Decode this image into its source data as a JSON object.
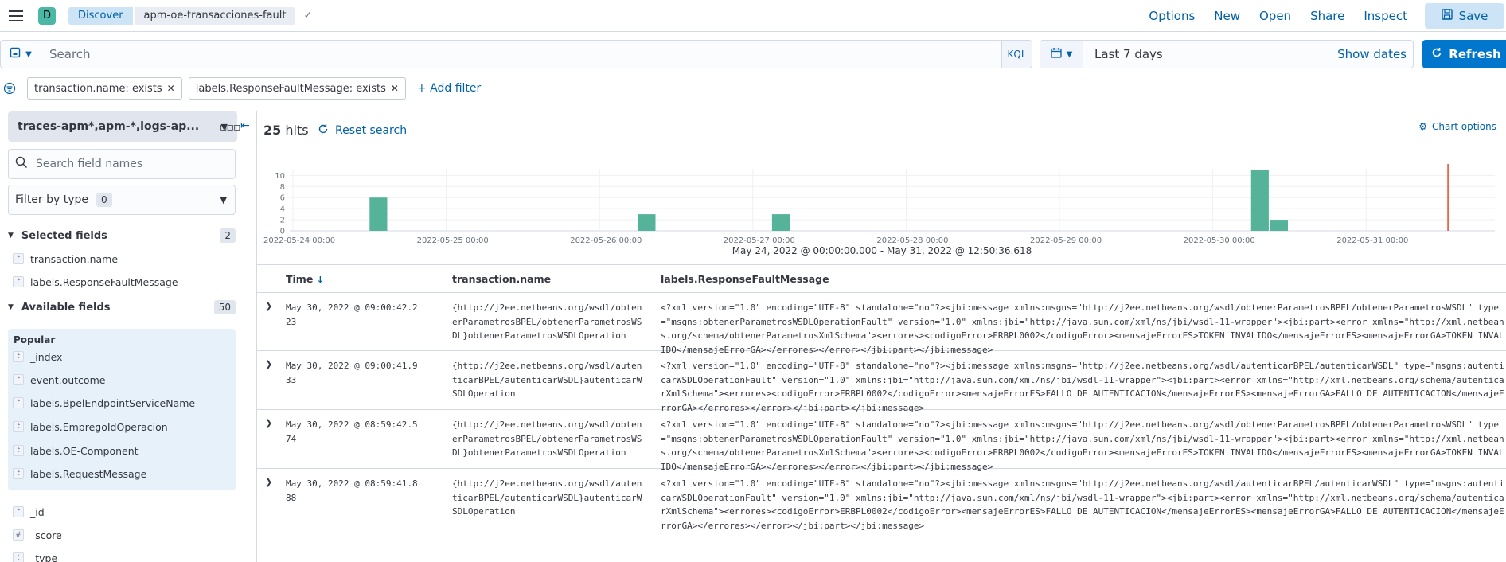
{
  "header": {
    "avatar_letter": "D",
    "breadcrumb_discover": "Discover",
    "breadcrumb_search": "apm-oe-transacciones-fault",
    "nav": [
      "Options",
      "New",
      "Open",
      "Share",
      "Inspect"
    ],
    "save_label": "Save"
  },
  "querybar": {
    "search_placeholder": "Search",
    "kql_label": "KQL",
    "date_label": "Last 7 days",
    "show_dates_label": "Show dates",
    "refresh_label": "Refresh"
  },
  "filters": {
    "pills": [
      "transaction.name: exists",
      "labels.ResponseFaultMessage: exists"
    ],
    "add_filter_label": "+ Add filter"
  },
  "sidebar": {
    "index_pattern": "traces-apm*,apm-*,logs-ap...",
    "field_search_placeholder": "Search field names",
    "filter_by_type_label": "Filter by type",
    "filter_by_type_count": "0",
    "selected_fields_label": "Selected fields",
    "selected_fields_count": "2",
    "selected_fields": [
      "transaction.name",
      "labels.ResponseFaultMessage"
    ],
    "available_fields_label": "Available fields",
    "available_fields_count": "50",
    "popular_label": "Popular",
    "popular_fields": [
      "_index",
      "event.outcome",
      "labels.BpelEndpointServiceName",
      "labels.EmpregoIdOperacion",
      "labels.OE-Component",
      "labels.RequestMessage"
    ],
    "other_fields": [
      {
        "type": "t",
        "name": "_id"
      },
      {
        "type": "#",
        "name": "_score"
      },
      {
        "type": "t",
        "name": "_type"
      }
    ]
  },
  "main": {
    "hits_count": "25",
    "hits_label": "hits",
    "reset_search_label": "Reset search",
    "chart_options_label": "Chart options",
    "chart_range": "May 24, 2022 @ 00:00:00.000 - May 31, 2022 @ 12:50:36.618",
    "columns": [
      "Time",
      "transaction.name",
      "labels.ResponseFaultMessage"
    ],
    "rows": [
      {
        "time": "May 30, 2022 @ 09:00:42.223",
        "name": "{http://j2ee.netbeans.org/wsdl/obtenerParametrosBPEL/obtenerParametrosWSDL}obtenerParametrosWSDLOperation",
        "msg": "<?xml version=\"1.0\" encoding=\"UTF-8\" standalone=\"no\"?><jbi:message xmlns:msgns=\"http://j2ee.netbeans.org/wsdl/obtenerParametrosBPEL/obtenerParametrosWSDL\" type=\"msgns:obtenerParametrosWSDLOperationFault\" version=\"1.0\" xmlns:jbi=\"http://java.sun.com/xml/ns/jbi/wsdl-11-wrapper\"><jbi:part><error xmlns=\"http://xml.netbeans.org/schema/obtenerParametrosXmlSchema\"><errores><codigoError>ERBPL0002</codigoError><mensajeErrorES>TOKEN INVALIDO</mensajeErrorES><mensajeErrorGA>TOKEN INVALIDO</mensajeErrorGA></errores></error></jbi:part></jbi:message>"
      },
      {
        "time": "May 30, 2022 @ 09:00:41.933",
        "name": "{http://j2ee.netbeans.org/wsdl/autenticarBPEL/autenticarWSDL}autenticarWSDLOperation",
        "msg": "<?xml version=\"1.0\" encoding=\"UTF-8\" standalone=\"no\"?><jbi:message xmlns:msgns=\"http://j2ee.netbeans.org/wsdl/autenticarBPEL/autenticarWSDL\" type=\"msgns:autenticarWSDLOperationFault\" version=\"1.0\" xmlns:jbi=\"http://java.sun.com/xml/ns/jbi/wsdl-11-wrapper\"><jbi:part><error xmlns=\"http://xml.netbeans.org/schema/autenticarXmlSchema\"><errores><codigoError>ERBPL0002</codigoError><mensajeErrorES>FALLO DE AUTENTICACION</mensajeErrorES><mensajeErrorGA>FALLO DE AUTENTICACION</mensajeErrorGA></errores></error></jbi:part></jbi:message>"
      },
      {
        "time": "May 30, 2022 @ 08:59:42.574",
        "name": "{http://j2ee.netbeans.org/wsdl/obtenerParametrosBPEL/obtenerParametrosWSDL}obtenerParametrosWSDLOperation",
        "msg": "<?xml version=\"1.0\" encoding=\"UTF-8\" standalone=\"no\"?><jbi:message xmlns:msgns=\"http://j2ee.netbeans.org/wsdl/obtenerParametrosBPEL/obtenerParametrosWSDL\" type=\"msgns:obtenerParametrosWSDLOperationFault\" version=\"1.0\" xmlns:jbi=\"http://java.sun.com/xml/ns/jbi/wsdl-11-wrapper\"><jbi:part><error xmlns=\"http://xml.netbeans.org/schema/obtenerParametrosXmlSchema\"><errores><codigoError>ERBPL0002</codigoError><mensajeErrorES>TOKEN INVALIDO</mensajeErrorES><mensajeErrorGA>TOKEN INVALIDO</mensajeErrorGA></errores></error></jbi:part></jbi:message>"
      },
      {
        "time": "May 30, 2022 @ 08:59:41.888",
        "name": "{http://j2ee.netbeans.org/wsdl/autenticarBPEL/autenticarWSDL}autenticarWSDLOperation",
        "msg": "<?xml version=\"1.0\" encoding=\"UTF-8\" standalone=\"no\"?><jbi:message xmlns:msgns=\"http://j2ee.netbeans.org/wsdl/autenticarBPEL/autenticarWSDL\" type=\"msgns:autenticarWSDLOperationFault\" version=\"1.0\" xmlns:jbi=\"http://java.sun.com/xml/ns/jbi/wsdl-11-wrapper\"><jbi:part><error xmlns=\"http://xml.netbeans.org/schema/autenticarXmlSchema\"><errores><codigoError>ERBPL0002</codigoError><mensajeErrorES>FALLO DE AUTENTICACION</mensajeErrorES><mensajeErrorGA>FALLO DE AUTENTICACION</mensajeErrorGA></errores></error></jbi:part></jbi:message>"
      }
    ]
  },
  "chart_data": {
    "type": "bar",
    "title": "",
    "xlabel": "",
    "ylabel": "",
    "ylim": [
      0,
      10
    ],
    "yticks": [
      0,
      2,
      4,
      6,
      8,
      10
    ],
    "xticks": [
      "2022-05-24 00:00",
      "2022-05-25 00:00",
      "2022-05-26 00:00",
      "2022-05-27 00:00",
      "2022-05-28 00:00",
      "2022-05-29 00:00",
      "2022-05-30 00:00",
      "2022-05-31 00:00"
    ],
    "x_range": [
      "2022-05-24 00:00",
      "2022-05-31 12:50"
    ],
    "bucket_hours": 3,
    "bars": [
      {
        "x": "2022-05-24 12:00",
        "value": 6
      },
      {
        "x": "2022-05-26 06:00",
        "value": 3
      },
      {
        "x": "2022-05-27 03:00",
        "value": 3
      },
      {
        "x": "2022-05-30 06:00",
        "value": 11
      },
      {
        "x": "2022-05-30 09:00",
        "value": 2
      }
    ],
    "now_marker": "2022-05-31 12:50",
    "bar_color": "#54b399",
    "marker_color": "#e7664c"
  }
}
